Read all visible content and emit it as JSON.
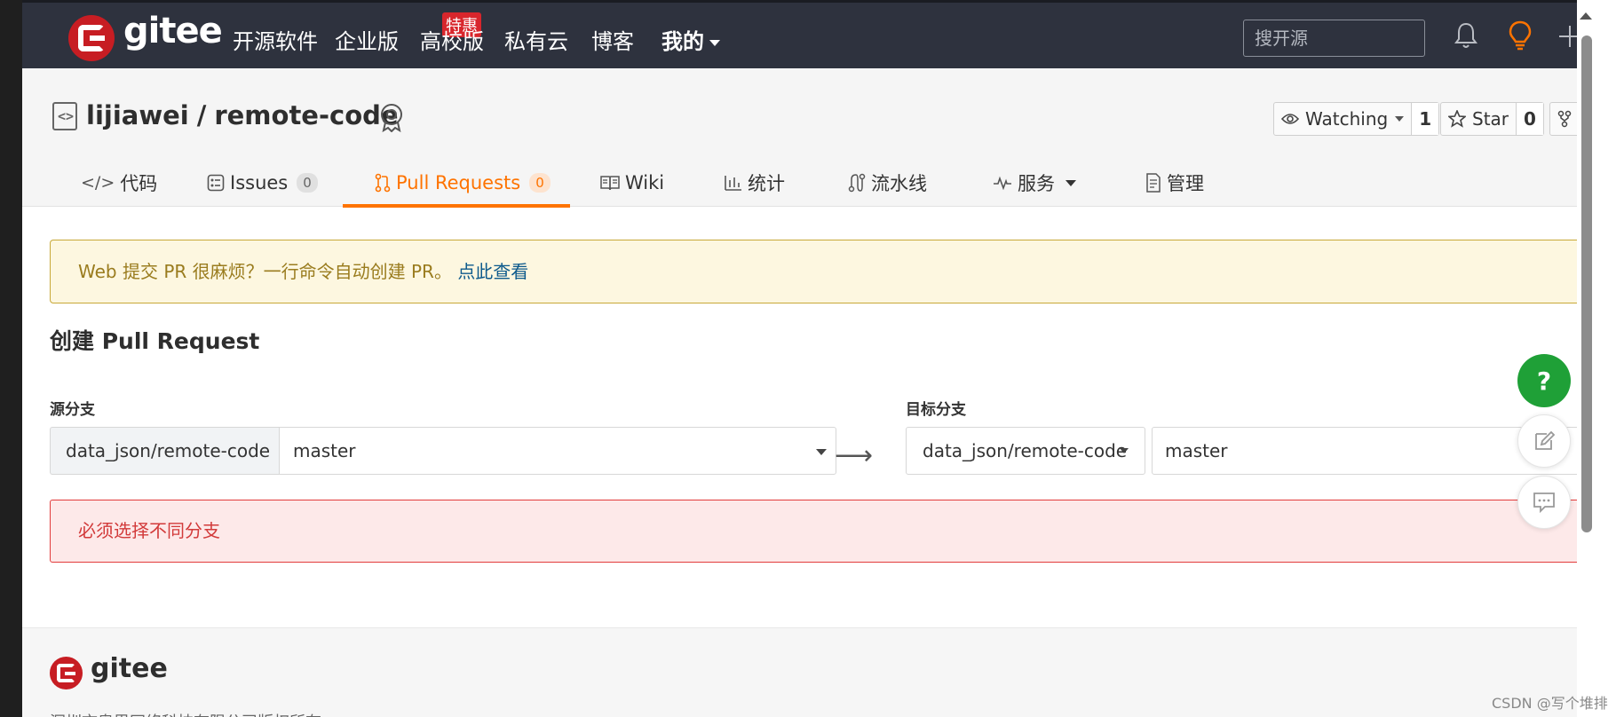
{
  "topnav": {
    "logo_text": "gitee",
    "items": [
      "开源软件",
      "企业版",
      "高校版",
      "私有云",
      "博客",
      "我的"
    ],
    "enterprise_badge": "特惠",
    "search_placeholder": "搜开源"
  },
  "repo": {
    "owner": "lijiawei",
    "separator": "/",
    "name": "remote-code",
    "watching_label": "Watching",
    "watching_count": "1",
    "star_label": "Star",
    "star_count": "0"
  },
  "tabs": [
    {
      "label": "代码"
    },
    {
      "label": "Issues",
      "count": "0"
    },
    {
      "label": "Pull Requests",
      "count": "0",
      "active": true
    },
    {
      "label": "Wiki"
    },
    {
      "label": "统计"
    },
    {
      "label": "流水线"
    },
    {
      "label": "服务"
    },
    {
      "label": "管理"
    }
  ],
  "notice": {
    "text": "Web 提交 PR 很麻烦？一行命令自动创建 PR。",
    "link": "点此查看"
  },
  "form": {
    "heading": "创建 Pull Request",
    "source_label": "源分支",
    "source_repo": "data_json/remote-code",
    "source_branch": "master",
    "target_label": "目标分支",
    "target_repo": "data_json/remote-code",
    "target_branch": "master",
    "arrow": "⟶",
    "error": "必须选择不同分支"
  },
  "footer": {
    "logo_text": "gitee",
    "copyright": "深圳市奥思网络科技有限公司版权所有"
  },
  "fab": {
    "help": "?"
  },
  "watermark": "CSDN @写个堆排",
  "colors": {
    "nav_bg": "#2e323e",
    "brand_red": "#c71d23",
    "accent_orange": "#fe7300",
    "help_green": "#1fa037",
    "error_red": "#d23a3a"
  }
}
